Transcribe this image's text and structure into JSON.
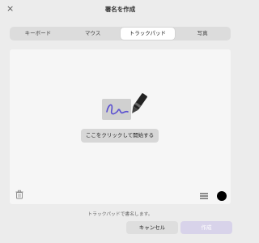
{
  "window": {
    "close_glyph": "×",
    "title": "署名を作成"
  },
  "tabs": [
    {
      "label": "キーボード",
      "active": false
    },
    {
      "label": "マウス",
      "active": false
    },
    {
      "label": "トラックパッド",
      "active": true
    },
    {
      "label": "写真",
      "active": false
    }
  ],
  "pad": {
    "start_label": "ここをクリックして開始する",
    "pen_color": "#000000"
  },
  "footer": {
    "hint": "トラックパッドで書名します。",
    "cancel_label": "キャンセル",
    "create_label": "作成"
  },
  "colors": {
    "accent_disabled": "#d8d3ea",
    "signature_ink": "#5a4fd0"
  }
}
